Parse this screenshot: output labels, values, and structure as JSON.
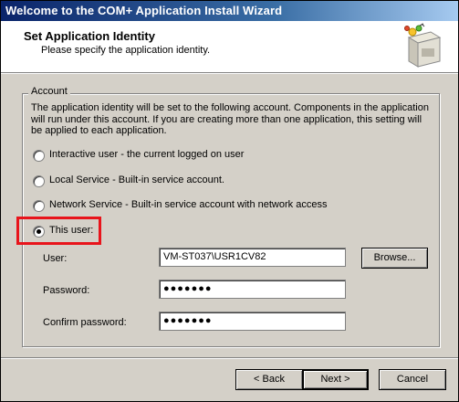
{
  "window": {
    "title": "Welcome to the COM+ Application Install Wizard"
  },
  "header": {
    "title": "Set Application Identity",
    "subtitle": "Please specify the application identity.",
    "icon": "package-install-icon"
  },
  "account": {
    "legend": "Account",
    "description": "The application identity will be set to the following account.  Components in the application will run under this account.  If you are creating more than one application, this setting will be applied to each application.",
    "options": [
      {
        "label": "Interactive user - the current logged on user",
        "selected": false
      },
      {
        "label": "Local Service - Built-in service account.",
        "selected": false
      },
      {
        "label": "Network Service - Built-in service account with network access",
        "selected": false
      },
      {
        "label": "This user:",
        "selected": true
      }
    ],
    "user_label": "User:",
    "user_value": "VM-ST037\\USR1CV82",
    "browse_label": "Browse...",
    "password_label": "Password:",
    "password_value": "●●●●●●●",
    "confirm_label": "Confirm password:",
    "confirm_value": "●●●●●●●"
  },
  "footer": {
    "back_label": "< Back",
    "next_label": "Next >",
    "cancel_label": "Cancel"
  },
  "colors": {
    "title_bar": "#0a246a",
    "dialog_face": "#d4d0c8",
    "highlight_box": "#e8141b"
  }
}
